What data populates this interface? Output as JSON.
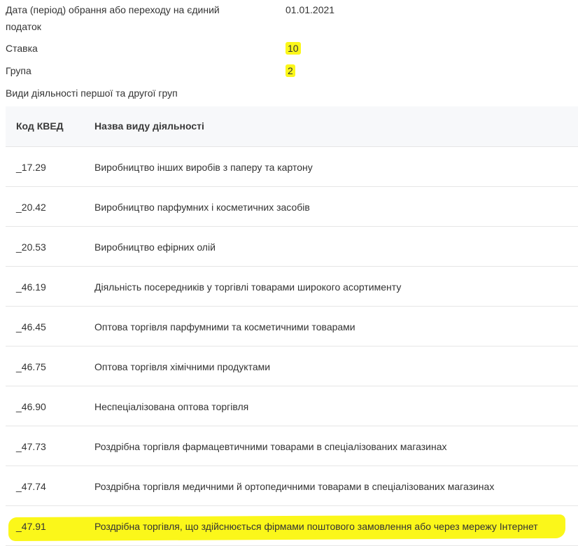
{
  "info": {
    "date_label_line1": "Дата (період) обрання або переходу на єдиний",
    "date_label_line2": "податок",
    "date_value": "01.01.2021",
    "rate_label": "Ставка",
    "rate_value": "10",
    "group_label": "Група",
    "group_value": "2",
    "activities_label": "Види діяльності першої та другої груп"
  },
  "table": {
    "headers": [
      "Код КВЕД",
      "Назва виду діяльності"
    ],
    "rows": [
      {
        "code": "_17.29",
        "name": "Виробництво інших виробів з паперу та картону"
      },
      {
        "code": "_20.42",
        "name": "Виробництво парфумних і косметичних засобів"
      },
      {
        "code": "_20.53",
        "name": "Виробництво ефірних олій"
      },
      {
        "code": "_46.19",
        "name": "Діяльність посередників у торгівлі товарами широкого асортименту"
      },
      {
        "code": "_46.45",
        "name": "Оптова торгівля парфумними та косметичними товарами"
      },
      {
        "code": "_46.75",
        "name": "Оптова торгівля хімічними продуктами"
      },
      {
        "code": "_46.90",
        "name": "Неспеціалізована оптова торгівля"
      },
      {
        "code": "_47.73",
        "name": "Роздрібна торгівля фармацевтичними товарами в спеціалізованих магазинах"
      },
      {
        "code": "_47.74",
        "name": "Роздрібна торгівля медичними й ортопедичними товарами в спеціалізованих магазинах"
      },
      {
        "code": "_47.91",
        "name": "Роздрібна торгівля, що здійснюється фірмами поштового замовлення або через мережу Інтернет"
      }
    ]
  },
  "colors": {
    "highlight": "#fbf71a",
    "header_bg": "#f7f8fa",
    "divider": "#e6e6e6",
    "text": "#333333"
  }
}
